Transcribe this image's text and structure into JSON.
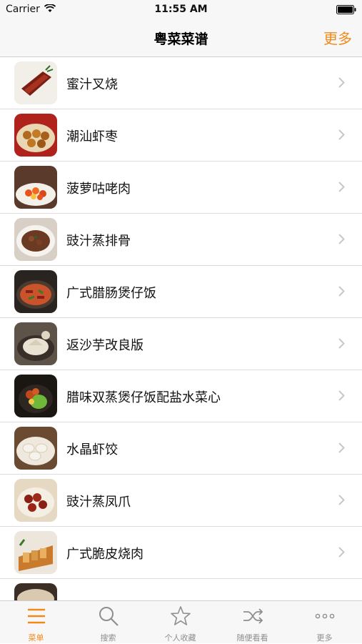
{
  "status_bar": {
    "carrier": "Carrier",
    "time": "11:55 AM"
  },
  "nav": {
    "title": "粤菜菜谱",
    "more": "更多"
  },
  "recipes": [
    {
      "name": "蜜汁叉烧"
    },
    {
      "name": "潮汕虾枣"
    },
    {
      "name": "菠萝咕咾肉"
    },
    {
      "name": "豉汁蒸排骨"
    },
    {
      "name": "广式腊肠煲仔饭"
    },
    {
      "name": "返沙芋改良版"
    },
    {
      "name": "腊味双蒸煲仔饭配盐水菜心"
    },
    {
      "name": "水晶虾饺"
    },
    {
      "name": "豉汁蒸凤爪"
    },
    {
      "name": "广式脆皮烧肉"
    }
  ],
  "tabs": [
    {
      "label": "菜单",
      "icon": "menu-icon",
      "active": true
    },
    {
      "label": "搜索",
      "icon": "search-icon",
      "active": false
    },
    {
      "label": "个人收藏",
      "icon": "star-icon",
      "active": false
    },
    {
      "label": "随便看看",
      "icon": "shuffle-icon",
      "active": false
    },
    {
      "label": "更多",
      "icon": "more-dots-icon",
      "active": false
    }
  ],
  "colors": {
    "accent": "#f08a1a",
    "inactive": "#8e8e8e",
    "bar_bg": "#f7f7f7"
  }
}
